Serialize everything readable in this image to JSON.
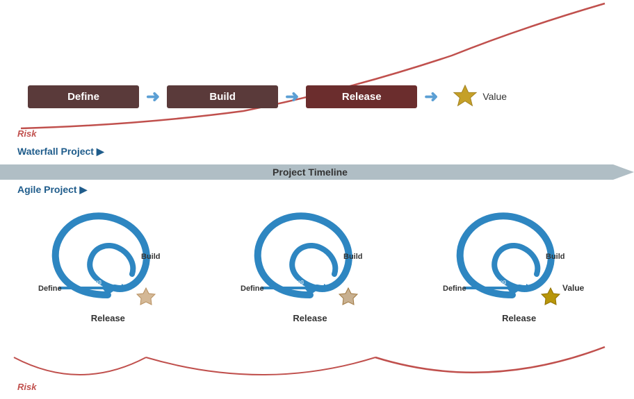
{
  "waterfall": {
    "boxes": [
      {
        "label": "Define",
        "type": "normal"
      },
      {
        "label": "Build",
        "type": "normal"
      },
      {
        "label": "Release",
        "type": "release"
      }
    ],
    "value_label": "Value",
    "risk_label": "Risk"
  },
  "timeline": {
    "waterfall_project_label": "Waterfall Project",
    "arrow_char": "▶",
    "project_timeline_label": "Project Timeline"
  },
  "agile": {
    "agile_project_label": "Agile Project",
    "arrow_char": "▶",
    "cycles": [
      {
        "define": "Define",
        "build": "Build",
        "release": "Release",
        "has_value": false
      },
      {
        "define": "Define",
        "build": "Build",
        "release": "Release",
        "has_value": false
      },
      {
        "define": "Define",
        "build": "Build",
        "release": "Release",
        "has_value": true
      }
    ],
    "value_label": "Value",
    "risk_label": "Risk"
  },
  "colors": {
    "box_bg": "#5a3a3a",
    "release_bg": "#6b2d2d",
    "arrow_blue": "#4a9fd4",
    "cycle_blue": "#2e86c1",
    "star_gold": "#c5a028",
    "star_light": "#d4b896",
    "risk_red": "#c0504d",
    "timeline_gray": "#b0bec5",
    "label_blue": "#1f5c8b"
  }
}
